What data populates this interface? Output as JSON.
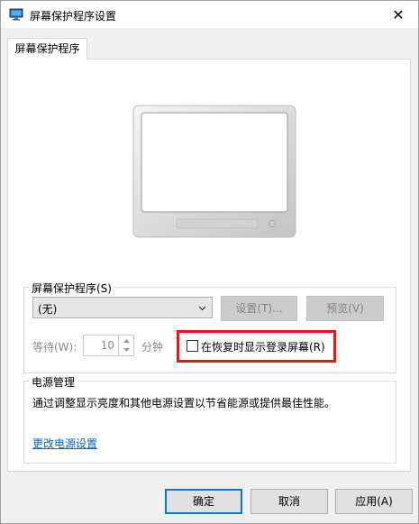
{
  "window": {
    "title": "屏幕保护程序设置",
    "close_glyph": "✕"
  },
  "tab": {
    "label": "屏幕保护程序"
  },
  "screensaver": {
    "group_label": "屏幕保护程序(S)",
    "selected": "(无)",
    "settings_button": "设置(T)...",
    "preview_button": "预览(V)",
    "wait_label": "等待(W):",
    "wait_value": "10",
    "minutes_label": "分钟",
    "resume_checkbox_label": "在恢复时显示登录屏幕(R)",
    "resume_checked": false
  },
  "power": {
    "group_label": "电源管理",
    "description": "通过调整显示亮度和其他电源设置以节省能源或提供最佳性能。",
    "link_label": "更改电源设置"
  },
  "footer": {
    "ok": "确定",
    "cancel": "取消",
    "apply": "应用(A)"
  },
  "colors": {
    "highlight_border": "#e8141b",
    "link": "#0066cc",
    "default_button_border": "#0078d7"
  }
}
